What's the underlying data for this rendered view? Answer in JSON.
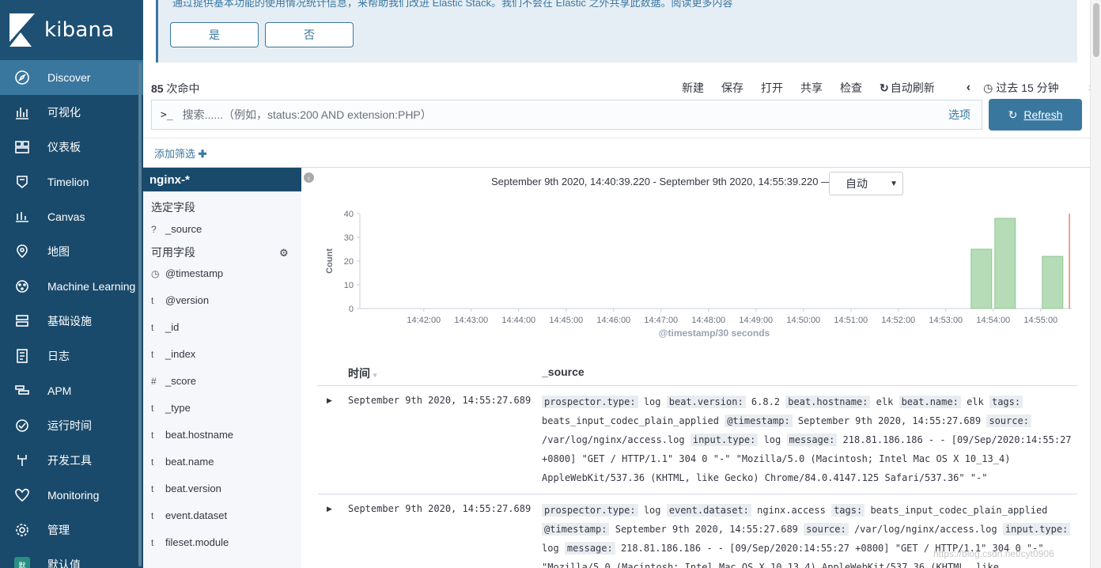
{
  "nav": {
    "brand": "kibana",
    "items": [
      {
        "label": "Discover",
        "icon": "compass-icon",
        "active": true
      },
      {
        "label": "可视化",
        "icon": "visualize-icon"
      },
      {
        "label": "仪表板",
        "icon": "dashboard-icon"
      },
      {
        "label": "Timelion",
        "icon": "timelion-icon"
      },
      {
        "label": "Canvas",
        "icon": "canvas-icon"
      },
      {
        "label": "地图",
        "icon": "map-icon"
      },
      {
        "label": "Machine Learning",
        "icon": "ml-icon"
      },
      {
        "label": "基础设施",
        "icon": "infra-icon"
      },
      {
        "label": "日志",
        "icon": "logs-icon"
      },
      {
        "label": "APM",
        "icon": "apm-icon"
      },
      {
        "label": "运行时间",
        "icon": "uptime-icon"
      },
      {
        "label": "开发工具",
        "icon": "devtools-icon"
      },
      {
        "label": "Monitoring",
        "icon": "monitoring-icon"
      },
      {
        "label": "管理",
        "icon": "gear-icon"
      },
      {
        "label": "默认值",
        "icon": "space-badge",
        "badge": "默"
      }
    ]
  },
  "banner": {
    "text": "通过提供基本功能的使用情况统计信息，来帮助我们改进 Elastic Stack。我们不会在 Elastic 之外共享此数据。阅读更多内容",
    "yes": "是",
    "no": "否"
  },
  "hits": {
    "count": "85",
    "label": "次命中"
  },
  "menu": {
    "new": "新建",
    "save": "保存",
    "open": "打开",
    "share": "共享",
    "inspect": "检查",
    "auto_refresh": "自动刷新",
    "time_range": "过去 15 分钟"
  },
  "search": {
    "prompt": ">_",
    "placeholder": "搜索......（例如，status:200 AND extension:PHP）",
    "options": "选项"
  },
  "refresh": "Refresh",
  "filter": {
    "add": "添加筛选"
  },
  "fields": {
    "index_pattern": "nginx-*",
    "selected_title": "选定字段",
    "selected": [
      {
        "type": "?",
        "name": "_source"
      }
    ],
    "available_title": "可用字段",
    "available": [
      {
        "type": "clock",
        "name": "@timestamp"
      },
      {
        "type": "t",
        "name": "@version"
      },
      {
        "type": "t",
        "name": "_id"
      },
      {
        "type": "t",
        "name": "_index"
      },
      {
        "type": "#",
        "name": "_score"
      },
      {
        "type": "t",
        "name": "_type"
      },
      {
        "type": "t",
        "name": "beat.hostname"
      },
      {
        "type": "t",
        "name": "beat.name"
      },
      {
        "type": "t",
        "name": "beat.version"
      },
      {
        "type": "t",
        "name": "event.dataset"
      },
      {
        "type": "t",
        "name": "fileset.module"
      }
    ]
  },
  "time_header": {
    "range": "September 9th 2020, 14:40:39.220 - September 9th 2020, 14:55:39.220 —",
    "interval": "自动"
  },
  "chart_data": {
    "type": "bar",
    "ylabel": "Count",
    "xlabel": "@timestamp/30 seconds",
    "ylim": [
      0,
      40
    ],
    "yticks": [
      0,
      10,
      20,
      30,
      40
    ],
    "xticks": [
      "14:42:00",
      "14:43:00",
      "14:44:00",
      "14:45:00",
      "14:46:00",
      "14:47:00",
      "14:48:00",
      "14:49:00",
      "14:50:00",
      "14:51:00",
      "14:52:00",
      "14:53:00",
      "14:54:00",
      "14:55:00"
    ],
    "bars": [
      {
        "x": "14:53:30",
        "value": 25
      },
      {
        "x": "14:54:00",
        "value": 38
      },
      {
        "x": "14:55:00",
        "value": 22
      }
    ],
    "bar_color": "#b5dcb7",
    "now_marker_color": "#e7664c"
  },
  "table": {
    "col_time": "时间",
    "col_source": "_source",
    "rows": [
      {
        "time": "September 9th 2020, 14:55:27.689",
        "source": [
          [
            "prospector.type:",
            "log"
          ],
          [
            "beat.version:",
            "6.8.2"
          ],
          [
            "beat.hostname:",
            "elk"
          ],
          [
            "beat.name:",
            "elk"
          ],
          [
            "tags:",
            "beats_input_codec_plain_applied"
          ],
          [
            "@timestamp:",
            "September 9th 2020, 14:55:27.689"
          ],
          [
            "source:",
            "/var/log/nginx/access.log"
          ],
          [
            "input.type:",
            "log"
          ],
          [
            "message:",
            "218.81.186.186 - - [09/Sep/2020:14:55:27 +0800] \"GET / HTTP/1.1\" 304 0 \"-\" \"Mozilla/5.0 (Macintosh; Intel Mac OS X 10_13_4) AppleWebKit/537.36 (KHTML, like Gecko) Chrome/84.0.4147.125 Safari/537.36\" \"-\""
          ]
        ]
      },
      {
        "time": "September 9th 2020, 14:55:27.689",
        "source": [
          [
            "prospector.type:",
            "log"
          ],
          [
            "event.dataset:",
            "nginx.access"
          ],
          [
            "tags:",
            "beats_input_codec_plain_applied"
          ],
          [
            "@timestamp:",
            "September 9th 2020, 14:55:27.689"
          ],
          [
            "source:",
            "/var/log/nginx/access.log"
          ],
          [
            "input.type:",
            "log"
          ],
          [
            "message:",
            "218.81.186.186 - - [09/Sep/2020:14:55:27 +0800] \"GET / HTTP/1.1\" 304 0 \"-\" \"Mozilla/5.0 (Macintosh; Intel Mac OS X 10_13_4) AppleWebKit/537.36 (KHTML, like"
          ]
        ]
      }
    ]
  },
  "watermark": "https://blog.csdn.net/cyt0906"
}
